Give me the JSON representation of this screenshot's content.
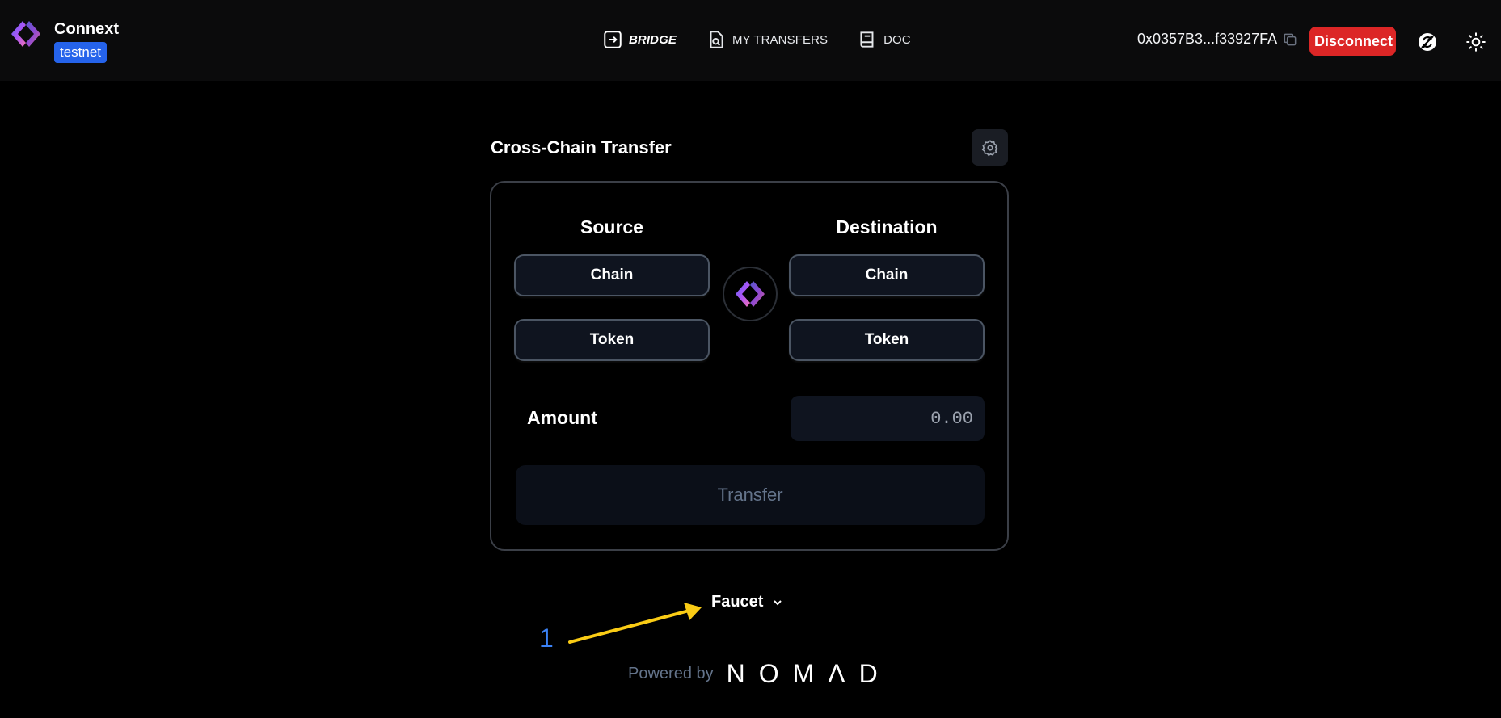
{
  "header": {
    "brand_name": "Connext",
    "network_badge": "testnet",
    "nav": [
      {
        "label": "BRIDGE",
        "icon": "enter-icon",
        "active": true
      },
      {
        "label": "MY TRANSFERS",
        "icon": "document-search-icon",
        "active": false
      },
      {
        "label": "DOC",
        "icon": "book-icon",
        "active": false
      }
    ],
    "wallet_address": "0x0357B3...f33927FA",
    "disconnect_label": "Disconnect"
  },
  "main": {
    "title": "Cross-Chain Transfer",
    "source": {
      "heading": "Source",
      "chain_label": "Chain",
      "token_label": "Token"
    },
    "destination": {
      "heading": "Destination",
      "chain_label": "Chain",
      "token_label": "Token"
    },
    "amount": {
      "label": "Amount",
      "placeholder": "0.00"
    },
    "transfer_label": "Transfer"
  },
  "footer": {
    "faucet_label": "Faucet",
    "powered_label": "Powered by",
    "powered_brand": "NOMΛD"
  },
  "annotation": {
    "number": "1",
    "color": "#3b82f6",
    "arrow_color": "#facc15"
  },
  "colors": {
    "disconnect": "#dc2626",
    "badge": "#2563eb",
    "background": "#000000"
  }
}
